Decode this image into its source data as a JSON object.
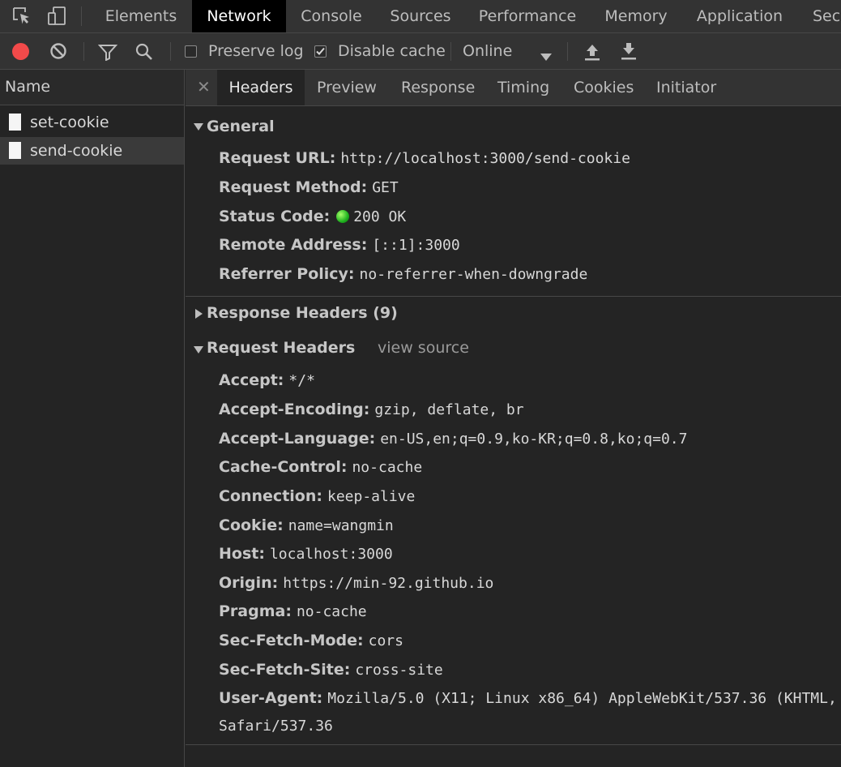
{
  "top_tabs": [
    {
      "label": "Elements"
    },
    {
      "label": "Network"
    },
    {
      "label": "Console"
    },
    {
      "label": "Sources"
    },
    {
      "label": "Performance"
    },
    {
      "label": "Memory"
    },
    {
      "label": "Application"
    },
    {
      "label": "Secu"
    }
  ],
  "top_icons": [
    "inspect-element-icon",
    "device-toolbar-icon"
  ],
  "toolbar": {
    "preserve_log_label": "Preserve log",
    "preserve_log_checked": false,
    "disable_cache_label": "Disable cache",
    "disable_cache_checked": true,
    "throttle_value": "Online",
    "record_color": "#f24a4a"
  },
  "name_column": {
    "header": "Name",
    "requests": [
      {
        "label": "set-cookie",
        "selected": false
      },
      {
        "label": "send-cookie",
        "selected": true
      }
    ]
  },
  "detail_tabs": [
    {
      "label": "Headers"
    },
    {
      "label": "Preview"
    },
    {
      "label": "Response"
    },
    {
      "label": "Timing"
    },
    {
      "label": "Cookies"
    },
    {
      "label": "Initiator"
    }
  ],
  "general": {
    "title": "General",
    "rows": [
      {
        "key": "Request URL:",
        "value": "http://localhost:3000/send-cookie"
      },
      {
        "key": "Request Method:",
        "value": "GET"
      },
      {
        "key": "Status Code:",
        "value": "200 OK"
      },
      {
        "key": "Remote Address:",
        "value": "[::1]:3000"
      },
      {
        "key": "Referrer Policy:",
        "value": "no-referrer-when-downgrade"
      }
    ]
  },
  "response_headers": {
    "title": "Response Headers (9)"
  },
  "request_headers": {
    "title": "Request Headers",
    "view_source": "view source",
    "rows": [
      {
        "key": "Accept:",
        "value": "*/*"
      },
      {
        "key": "Accept-Encoding:",
        "value": "gzip, deflate, br"
      },
      {
        "key": "Accept-Language:",
        "value": "en-US,en;q=0.9,ko-KR;q=0.8,ko;q=0.7"
      },
      {
        "key": "Cache-Control:",
        "value": "no-cache"
      },
      {
        "key": "Connection:",
        "value": "keep-alive"
      },
      {
        "key": "Cookie:",
        "value": "name=wangmin"
      },
      {
        "key": "Host:",
        "value": "localhost:3000"
      },
      {
        "key": "Origin:",
        "value": "https://min-92.github.io"
      },
      {
        "key": "Pragma:",
        "value": "no-cache"
      },
      {
        "key": "Sec-Fetch-Mode:",
        "value": "cors"
      },
      {
        "key": "Sec-Fetch-Site:",
        "value": "cross-site"
      },
      {
        "key": "User-Agent:",
        "value": "Mozilla/5.0 (X11; Linux x86_64) AppleWebKit/537.36 (KHTML,"
      }
    ],
    "user_agent_wrap": "Safari/537.36"
  }
}
